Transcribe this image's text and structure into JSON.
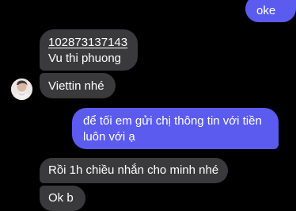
{
  "conversation": {
    "messages": [
      {
        "direction": "outgoing",
        "text": "oke"
      },
      {
        "direction": "incoming",
        "account_number": "102873137143",
        "account_name": "Vu thi phuong"
      },
      {
        "direction": "incoming",
        "text": "Viettin nhé"
      },
      {
        "direction": "outgoing",
        "text": "để tối em gửi chị thông tin với tiền luôn với ạ"
      },
      {
        "direction": "incoming",
        "text": "Rồi 1h chiều nhắn cho minh nhé"
      },
      {
        "direction": "incoming",
        "text": "Ok b"
      }
    ]
  },
  "colors": {
    "background": "#000000",
    "incoming_bubble": "#3a3a3c",
    "outgoing_bubble": "#5b5bf0",
    "text": "#ffffff"
  }
}
